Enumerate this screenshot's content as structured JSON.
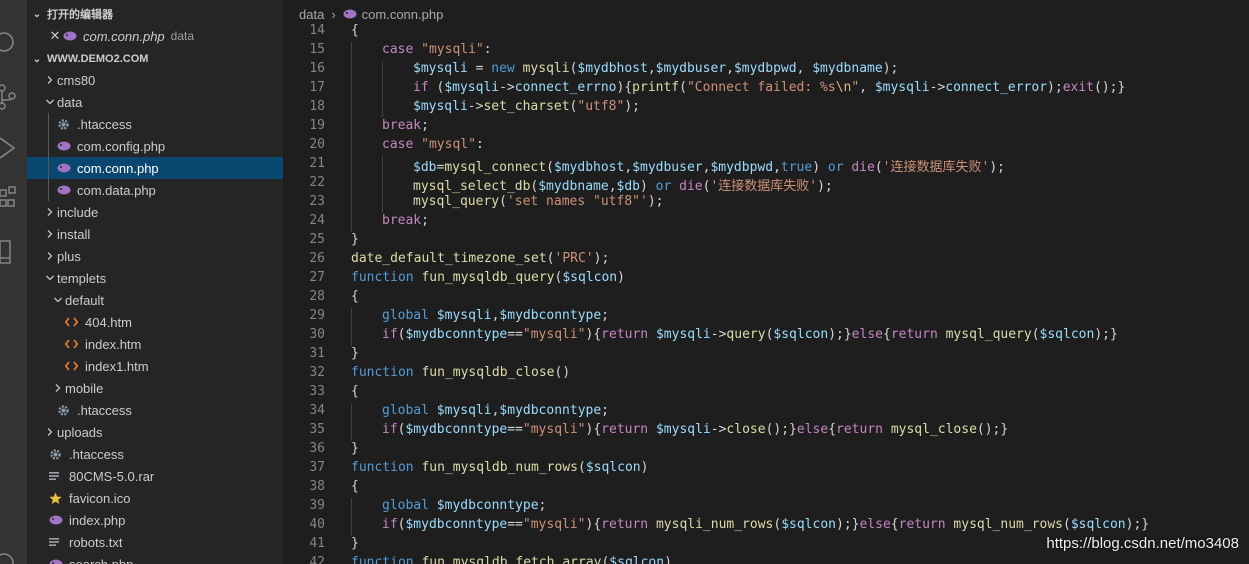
{
  "activity_bar": {
    "icons": [
      "search-icon",
      "source-control-icon",
      "run-debug-icon",
      "extensions-icon",
      "remote-explorer-icon",
      "account-icon"
    ]
  },
  "sidebar": {
    "open_editors": {
      "title": "打开的编辑器",
      "items": [
        {
          "name": "com.conn.php",
          "description": "data",
          "icon": "php-icon"
        }
      ]
    },
    "workspace": {
      "title": "WWW.DEMO2.COM",
      "tree": [
        {
          "label": "cms80",
          "kind": "folder",
          "expanded": false,
          "depth": 1
        },
        {
          "label": "data",
          "kind": "folder",
          "expanded": true,
          "depth": 1
        },
        {
          "label": ".htaccess",
          "kind": "gear",
          "depth": 2
        },
        {
          "label": "com.config.php",
          "kind": "php",
          "depth": 2
        },
        {
          "label": "com.conn.php",
          "kind": "php",
          "depth": 2,
          "selected": true
        },
        {
          "label": "com.data.php",
          "kind": "php",
          "depth": 2
        },
        {
          "label": "include",
          "kind": "folder",
          "expanded": false,
          "depth": 1
        },
        {
          "label": "install",
          "kind": "folder",
          "expanded": false,
          "depth": 1
        },
        {
          "label": "plus",
          "kind": "folder",
          "expanded": false,
          "depth": 1
        },
        {
          "label": "templets",
          "kind": "folder",
          "expanded": true,
          "depth": 1
        },
        {
          "label": "default",
          "kind": "folder",
          "expanded": true,
          "depth": 2
        },
        {
          "label": "404.htm",
          "kind": "html",
          "depth": 3
        },
        {
          "label": "index.htm",
          "kind": "html",
          "depth": 3
        },
        {
          "label": "index1.htm",
          "kind": "html",
          "depth": 3
        },
        {
          "label": "mobile",
          "kind": "folder",
          "expanded": false,
          "depth": 2
        },
        {
          "label": ".htaccess",
          "kind": "gear",
          "depth": 2
        },
        {
          "label": "uploads",
          "kind": "folder",
          "expanded": false,
          "depth": 1
        },
        {
          "label": ".htaccess",
          "kind": "gear",
          "depth": 1
        },
        {
          "label": "80CMS-5.0.rar",
          "kind": "text",
          "depth": 1
        },
        {
          "label": "favicon.ico",
          "kind": "star",
          "depth": 1
        },
        {
          "label": "index.php",
          "kind": "php",
          "depth": 1
        },
        {
          "label": "robots.txt",
          "kind": "text",
          "depth": 1
        },
        {
          "label": "search.php",
          "kind": "php",
          "depth": 1
        }
      ]
    }
  },
  "editor": {
    "breadcrumb": {
      "folder": "data",
      "file": "com.conn.php"
    },
    "lines": [
      {
        "n": "14",
        "i": 0,
        "t": [
          [
            "{",
            "plain"
          ]
        ]
      },
      {
        "n": "15",
        "i": 1,
        "t": [
          [
            "case ",
            "kw"
          ],
          [
            "\"mysqli\"",
            "str"
          ],
          [
            ":",
            "plain"
          ]
        ]
      },
      {
        "n": "16",
        "i": 2,
        "t": [
          [
            "$mysqli",
            "var"
          ],
          [
            " = ",
            "plain"
          ],
          [
            "new ",
            "dec"
          ],
          [
            "mysqli",
            "fn"
          ],
          [
            "(",
            "plain"
          ],
          [
            "$mydbhost",
            "var"
          ],
          [
            ",",
            "plain"
          ],
          [
            "$mydbuser",
            "var"
          ],
          [
            ",",
            "plain"
          ],
          [
            "$mydbpwd",
            "var"
          ],
          [
            ", ",
            "plain"
          ],
          [
            "$mydbname",
            "var"
          ],
          [
            ");",
            "plain"
          ]
        ]
      },
      {
        "n": "17",
        "i": 2,
        "t": [
          [
            "if ",
            "kw"
          ],
          [
            "(",
            "plain"
          ],
          [
            "$mysqli",
            "var"
          ],
          [
            "->",
            "plain"
          ],
          [
            "connect_errno",
            "var"
          ],
          [
            "){",
            "plain"
          ],
          [
            "printf",
            "fn"
          ],
          [
            "(",
            "plain"
          ],
          [
            "\"Connect failed: %s",
            "str"
          ],
          [
            "\\n",
            "esc"
          ],
          [
            "\"",
            "str"
          ],
          [
            ", ",
            "plain"
          ],
          [
            "$mysqli",
            "var"
          ],
          [
            "->",
            "plain"
          ],
          [
            "connect_error",
            "var"
          ],
          [
            ");",
            "plain"
          ],
          [
            "exit",
            "kw"
          ],
          [
            "();}",
            "plain"
          ]
        ]
      },
      {
        "n": "18",
        "i": 2,
        "t": [
          [
            "$mysqli",
            "var"
          ],
          [
            "->",
            "plain"
          ],
          [
            "set_charset",
            "fn"
          ],
          [
            "(",
            "plain"
          ],
          [
            "\"utf8\"",
            "str"
          ],
          [
            ");",
            "plain"
          ]
        ]
      },
      {
        "n": "19",
        "i": 1,
        "t": [
          [
            "break",
            "kw"
          ],
          [
            ";",
            "plain"
          ]
        ]
      },
      {
        "n": "20",
        "i": 1,
        "t": [
          [
            "case ",
            "kw"
          ],
          [
            "\"mysql\"",
            "str"
          ],
          [
            ":",
            "plain"
          ]
        ]
      },
      {
        "n": "21",
        "i": 2,
        "t": [
          [
            "$db",
            "var"
          ],
          [
            "=",
            "plain"
          ],
          [
            "mysql_connect",
            "fn"
          ],
          [
            "(",
            "plain"
          ],
          [
            "$mydbhost",
            "var"
          ],
          [
            ",",
            "plain"
          ],
          [
            "$mydbuser",
            "var"
          ],
          [
            ",",
            "plain"
          ],
          [
            "$mydbpwd",
            "var"
          ],
          [
            ",",
            "plain"
          ],
          [
            "true",
            "dec"
          ],
          [
            ") ",
            "plain"
          ],
          [
            "or ",
            "dec"
          ],
          [
            "die",
            "kw"
          ],
          [
            "(",
            "plain"
          ],
          [
            "'连接数据库失败'",
            "str"
          ],
          [
            ");",
            "plain"
          ]
        ]
      },
      {
        "n": "22",
        "i": 2,
        "t": [
          [
            "mysql_select_db",
            "fn"
          ],
          [
            "(",
            "plain"
          ],
          [
            "$mydbname",
            "var"
          ],
          [
            ",",
            "plain"
          ],
          [
            "$db",
            "var"
          ],
          [
            ") ",
            "plain"
          ],
          [
            "or ",
            "dec"
          ],
          [
            "die",
            "kw"
          ],
          [
            "(",
            "plain"
          ],
          [
            "'连接数据库失败'",
            "str"
          ],
          [
            ");",
            "plain"
          ]
        ]
      },
      {
        "n": "23",
        "i": 2,
        "t": [
          [
            "mysql_query",
            "fn"
          ],
          [
            "(",
            "plain"
          ],
          [
            "'set names \"utf8\"'",
            "str"
          ],
          [
            ");",
            "plain"
          ]
        ]
      },
      {
        "n": "24",
        "i": 1,
        "t": [
          [
            "break",
            "kw"
          ],
          [
            ";",
            "plain"
          ]
        ]
      },
      {
        "n": "25",
        "i": 0,
        "t": [
          [
            "}",
            "plain"
          ]
        ]
      },
      {
        "n": "26",
        "i": 0,
        "t": [
          [
            "date_default_timezone_set",
            "fn"
          ],
          [
            "(",
            "plain"
          ],
          [
            "'PRC'",
            "str"
          ],
          [
            ");",
            "plain"
          ]
        ]
      },
      {
        "n": "27",
        "i": 0,
        "t": [
          [
            "function ",
            "dec"
          ],
          [
            "fun_mysqldb_query",
            "fn"
          ],
          [
            "(",
            "plain"
          ],
          [
            "$sqlcon",
            "var"
          ],
          [
            ")",
            "plain"
          ]
        ]
      },
      {
        "n": "28",
        "i": 0,
        "t": [
          [
            "{",
            "plain"
          ]
        ]
      },
      {
        "n": "29",
        "i": 1,
        "t": [
          [
            "global ",
            "dec"
          ],
          [
            "$mysqli",
            "var"
          ],
          [
            ",",
            "plain"
          ],
          [
            "$mydbconntype",
            "var"
          ],
          [
            ";",
            "plain"
          ]
        ]
      },
      {
        "n": "30",
        "i": 1,
        "t": [
          [
            "if",
            "kw"
          ],
          [
            "(",
            "plain"
          ],
          [
            "$mydbconntype",
            "var"
          ],
          [
            "==",
            "plain"
          ],
          [
            "\"mysqli\"",
            "str"
          ],
          [
            "){",
            "plain"
          ],
          [
            "return ",
            "kw"
          ],
          [
            "$mysqli",
            "var"
          ],
          [
            "->",
            "plain"
          ],
          [
            "query",
            "fn"
          ],
          [
            "(",
            "plain"
          ],
          [
            "$sqlcon",
            "var"
          ],
          [
            ");}",
            "plain"
          ],
          [
            "else",
            "kw"
          ],
          [
            "{",
            "plain"
          ],
          [
            "return ",
            "kw"
          ],
          [
            "mysql_query",
            "fn"
          ],
          [
            "(",
            "plain"
          ],
          [
            "$sqlcon",
            "var"
          ],
          [
            ");}",
            "plain"
          ]
        ]
      },
      {
        "n": "31",
        "i": 0,
        "t": [
          [
            "}",
            "plain"
          ]
        ]
      },
      {
        "n": "32",
        "i": 0,
        "t": [
          [
            "function ",
            "dec"
          ],
          [
            "fun_mysqldb_close",
            "fn"
          ],
          [
            "()",
            "plain"
          ]
        ]
      },
      {
        "n": "33",
        "i": 0,
        "t": [
          [
            "{",
            "plain"
          ]
        ]
      },
      {
        "n": "34",
        "i": 1,
        "t": [
          [
            "global ",
            "dec"
          ],
          [
            "$mysqli",
            "var"
          ],
          [
            ",",
            "plain"
          ],
          [
            "$mydbconntype",
            "var"
          ],
          [
            ";",
            "plain"
          ]
        ]
      },
      {
        "n": "35",
        "i": 1,
        "t": [
          [
            "if",
            "kw"
          ],
          [
            "(",
            "plain"
          ],
          [
            "$mydbconntype",
            "var"
          ],
          [
            "==",
            "plain"
          ],
          [
            "\"mysqli\"",
            "str"
          ],
          [
            "){",
            "plain"
          ],
          [
            "return ",
            "kw"
          ],
          [
            "$mysqli",
            "var"
          ],
          [
            "->",
            "plain"
          ],
          [
            "close",
            "fn"
          ],
          [
            "();}",
            "plain"
          ],
          [
            "else",
            "kw"
          ],
          [
            "{",
            "plain"
          ],
          [
            "return ",
            "kw"
          ],
          [
            "mysql_close",
            "fn"
          ],
          [
            "();}",
            "plain"
          ]
        ]
      },
      {
        "n": "36",
        "i": 0,
        "t": [
          [
            "}",
            "plain"
          ]
        ]
      },
      {
        "n": "37",
        "i": 0,
        "t": [
          [
            "function ",
            "dec"
          ],
          [
            "fun_mysqldb_num_rows",
            "fn"
          ],
          [
            "(",
            "plain"
          ],
          [
            "$sqlcon",
            "var"
          ],
          [
            ")",
            "plain"
          ]
        ]
      },
      {
        "n": "38",
        "i": 0,
        "t": [
          [
            "{",
            "plain"
          ]
        ]
      },
      {
        "n": "39",
        "i": 1,
        "t": [
          [
            "global ",
            "dec"
          ],
          [
            "$mydbconntype",
            "var"
          ],
          [
            ";",
            "plain"
          ]
        ]
      },
      {
        "n": "40",
        "i": 1,
        "t": [
          [
            "if",
            "kw"
          ],
          [
            "(",
            "plain"
          ],
          [
            "$mydbconntype",
            "var"
          ],
          [
            "==",
            "plain"
          ],
          [
            "\"mysqli\"",
            "str"
          ],
          [
            "){",
            "plain"
          ],
          [
            "return ",
            "kw"
          ],
          [
            "mysqli_num_rows",
            "fn"
          ],
          [
            "(",
            "plain"
          ],
          [
            "$sqlcon",
            "var"
          ],
          [
            ");}",
            "plain"
          ],
          [
            "else",
            "kw"
          ],
          [
            "{",
            "plain"
          ],
          [
            "return ",
            "kw"
          ],
          [
            "mysql_num_rows",
            "fn"
          ],
          [
            "(",
            "plain"
          ],
          [
            "$sqlcon",
            "var"
          ],
          [
            ");}",
            "plain"
          ]
        ]
      },
      {
        "n": "41",
        "i": 0,
        "t": [
          [
            "}",
            "plain"
          ]
        ]
      },
      {
        "n": "42",
        "i": 0,
        "t": [
          [
            "function ",
            "dec"
          ],
          [
            "fun_mysqldb_fetch_array",
            "fn"
          ],
          [
            "(",
            "plain"
          ],
          [
            "$sqlcon",
            "var"
          ],
          [
            ")",
            "plain"
          ]
        ]
      }
    ]
  },
  "watermark": "https://blog.csdn.net/mo3408",
  "colors": {
    "keyword": "#c586c0",
    "string": "#ce9178",
    "variable": "#9cdcfe",
    "function": "#dcdcaa",
    "declaration": "#569cd6",
    "selection": "#094771"
  }
}
